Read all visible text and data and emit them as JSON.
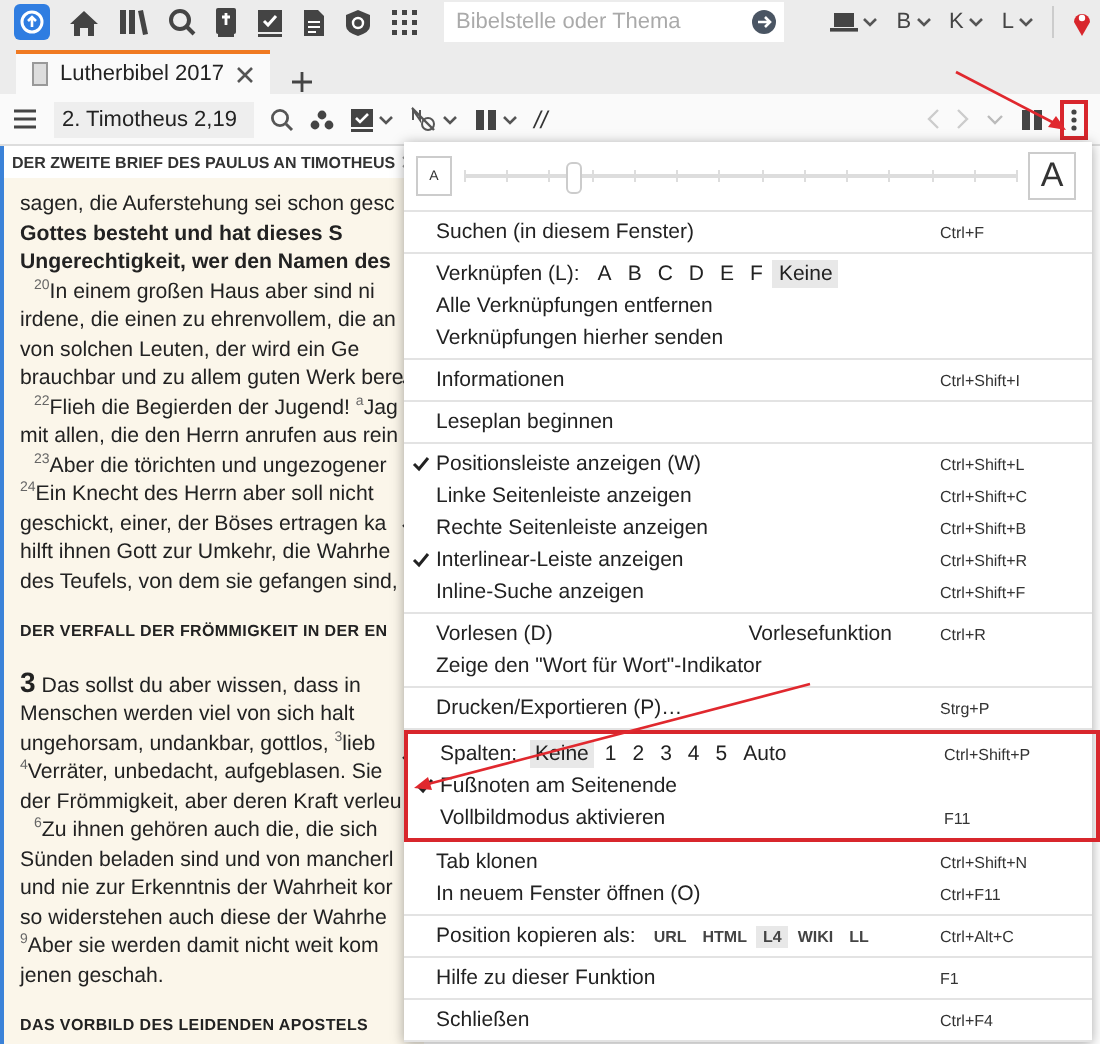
{
  "top_bar": {
    "search": {
      "placeholder": "Bibelstelle oder Thema"
    },
    "menus": [
      {
        "label": "B"
      },
      {
        "label": "K"
      },
      {
        "label": "L"
      }
    ]
  },
  "tabs": [
    {
      "label": "Lutherbibel 2017",
      "selected": true
    }
  ],
  "toolbar": {
    "reference": "2. Timotheus 2,19",
    "parallel": "//"
  },
  "document": {
    "breadcrumb": "DER ZWEITE BRIEF DES PAULUS AN TIMOTHEUS",
    "blocks": [
      {
        "kind": "line",
        "text": "sagen, die Auferstehung sei schon gesc"
      },
      {
        "kind": "bold",
        "text": "Gottes besteht und hat dieses S"
      },
      {
        "kind": "bold",
        "text": "Ungerechtigkeit, wer den Namen des"
      },
      {
        "kind": "verse",
        "text": "$^{20}$In einem großen Haus aber sind ni"
      },
      {
        "kind": "line",
        "text": "irdene, die einen zu ehrenvollem, die an"
      },
      {
        "kind": "line",
        "text": "von solchen Leuten, der wird ein Ge"
      },
      {
        "kind": "line",
        "text": "brauchbar und zu allem guten Werk bere"
      },
      {
        "kind": "verse",
        "text": "$^{22}$Flieh die Begierden der Jugend! $^{a}$Jag"
      },
      {
        "kind": "line",
        "text": "mit allen, die den Herrn anrufen aus rein"
      },
      {
        "kind": "verse",
        "text": "$^{23}$Aber die törichten und ungezogener"
      },
      {
        "kind": "line",
        "text": "$^{24}$Ein Knecht des Herrn aber soll nicht"
      },
      {
        "kind": "line",
        "text": "geschickt, einer, der Böses ertragen ka"
      },
      {
        "kind": "line",
        "text": "hilft ihnen Gott zur Umkehr, die Wahrhe"
      },
      {
        "kind": "line",
        "text": "des Teufels, von dem sie gefangen sind,"
      },
      {
        "kind": "heading",
        "text": "DER VERFALL DER FRÖMMIGKEIT IN DER EN"
      },
      {
        "kind": "chapter",
        "number": "3",
        "text": "Das sollst du aber wissen, dass in"
      },
      {
        "kind": "line",
        "text": "Menschen werden viel von sich halt"
      },
      {
        "kind": "line",
        "text": "ungehorsam, undankbar, gottlos, $^{3}$lieb"
      },
      {
        "kind": "line",
        "text": "$^{4}$Verräter, unbedacht, aufgeblasen. Sie"
      },
      {
        "kind": "line",
        "text": "der Frömmigkeit, aber deren Kraft verleu"
      },
      {
        "kind": "verse",
        "text": "$^{6}$Zu ihnen gehören auch die, die sich"
      },
      {
        "kind": "line",
        "text": "Sünden beladen sind und von mancherl"
      },
      {
        "kind": "line",
        "text": "und nie zur Erkenntnis der Wahrheit kor"
      },
      {
        "kind": "line",
        "text": "so widerstehen auch diese der Wahrhe"
      },
      {
        "kind": "line",
        "text": "$^{9}$Aber sie werden damit nicht weit kom"
      },
      {
        "kind": "line",
        "text": "jenen geschah."
      },
      {
        "kind": "heading",
        "text": "DAS VORBILD DES LEIDENDEN APOSTELS"
      }
    ]
  },
  "menu": {
    "font_size": {
      "small": "A",
      "large": "A",
      "level": 0.2
    },
    "sections": [
      {
        "highlighted": false,
        "items": [
          {
            "kind": "item",
            "label": "Suchen (in diesem Fenster)",
            "shortcut": "Ctrl+F",
            "checked": false
          }
        ]
      },
      {
        "highlighted": false,
        "items": [
          {
            "kind": "options",
            "label": "Verknüpfen (L):",
            "options": [
              {
                "label": "A",
                "selected": false
              },
              {
                "label": "B",
                "selected": false
              },
              {
                "label": "C",
                "selected": false
              },
              {
                "label": "D",
                "selected": false
              },
              {
                "label": "E",
                "selected": false
              },
              {
                "label": "F",
                "selected": false
              },
              {
                "label": "Keine",
                "selected": true
              }
            ]
          },
          {
            "kind": "item",
            "label": "Alle Verknüpfungen entfernen",
            "checked": false
          },
          {
            "kind": "item",
            "label": "Verknüpfungen hierher senden",
            "checked": false
          }
        ]
      },
      {
        "highlighted": false,
        "items": [
          {
            "kind": "item",
            "label": "Informationen",
            "shortcut": "Ctrl+Shift+I",
            "checked": false
          }
        ]
      },
      {
        "highlighted": false,
        "items": [
          {
            "kind": "item",
            "label": "Leseplan beginnen",
            "checked": false
          }
        ]
      },
      {
        "highlighted": false,
        "items": [
          {
            "kind": "item",
            "label": "Positionsleiste anzeigen (W)",
            "shortcut": "Ctrl+Shift+L",
            "checked": true
          },
          {
            "kind": "item",
            "label": "Linke Seitenleiste anzeigen",
            "shortcut": "Ctrl+Shift+C",
            "checked": false
          },
          {
            "kind": "item",
            "label": "Rechte Seitenleiste anzeigen",
            "shortcut": "Ctrl+Shift+B",
            "checked": false
          },
          {
            "kind": "item",
            "label": "Interlinear-Leiste anzeigen",
            "shortcut": "Ctrl+Shift+R",
            "checked": true
          },
          {
            "kind": "item",
            "label": "Inline-Suche anzeigen",
            "shortcut": "Ctrl+Shift+F",
            "checked": false
          }
        ]
      },
      {
        "highlighted": false,
        "items": [
          {
            "kind": "item",
            "label": "Vorlesen (D)",
            "extra": "Vorlesefunktion",
            "shortcut": "Ctrl+R",
            "checked": false
          },
          {
            "kind": "item",
            "label": "Zeige den \"Wort für Wort\"-Indikator",
            "checked": false
          }
        ]
      },
      {
        "highlighted": false,
        "items": [
          {
            "kind": "item",
            "label": "Drucken/Exportieren (P)…",
            "shortcut": "Strg+P",
            "checked": false
          }
        ]
      },
      {
        "highlighted": true,
        "items": [
          {
            "kind": "options",
            "label": "Spalten:",
            "options": [
              {
                "label": "Keine",
                "selected": true
              },
              {
                "label": "1",
                "selected": false
              },
              {
                "label": "2",
                "selected": false
              },
              {
                "label": "3",
                "selected": false
              },
              {
                "label": "4",
                "selected": false
              },
              {
                "label": "5",
                "selected": false
              },
              {
                "label": "Auto",
                "selected": false
              }
            ],
            "shortcut": "Ctrl+Shift+P"
          },
          {
            "kind": "item",
            "label": "Fußnoten am Seitenende",
            "checked": true
          },
          {
            "kind": "item",
            "label": "Vollbildmodus aktivieren",
            "shortcut": "F11",
            "checked": false
          }
        ]
      },
      {
        "highlighted": false,
        "items": [
          {
            "kind": "item",
            "label": "Tab klonen",
            "shortcut": "Ctrl+Shift+N",
            "checked": false
          },
          {
            "kind": "item",
            "label": "In neuem Fenster öffnen (O)",
            "shortcut": "Ctrl+F11",
            "checked": false
          }
        ]
      },
      {
        "highlighted": false,
        "items": [
          {
            "kind": "tags",
            "label": "Position kopieren als:",
            "options": [
              {
                "label": "URL",
                "selected": false
              },
              {
                "label": "HTML",
                "selected": false
              },
              {
                "label": "L4",
                "selected": true
              },
              {
                "label": "WIKI",
                "selected": false
              },
              {
                "label": "LL",
                "selected": false
              }
            ],
            "shortcut": "Ctrl+Alt+C"
          }
        ]
      },
      {
        "highlighted": false,
        "items": [
          {
            "kind": "item",
            "label": "Hilfe zu dieser Funktion",
            "shortcut": "F1",
            "checked": false
          }
        ]
      },
      {
        "highlighted": false,
        "items": [
          {
            "kind": "item",
            "label": "Schließen",
            "shortcut": "Ctrl+F4",
            "checked": false
          }
        ]
      }
    ]
  }
}
